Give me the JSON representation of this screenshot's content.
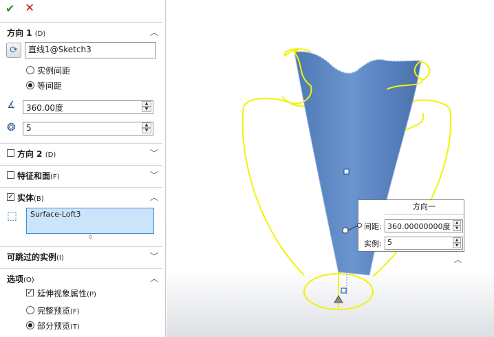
{
  "toolbar": {
    "ok_glyph": "✔",
    "cancel_glyph": "✕"
  },
  "direction1": {
    "title": "方向 1",
    "shortcut": "(D)",
    "reference": "直线1@Sketch3",
    "option_instance_spacing": "实例间距",
    "option_equal_spacing": "等间距",
    "angle": "360.00度",
    "count": "5",
    "selected_option": "等间距"
  },
  "direction2": {
    "title": "方向 2",
    "shortcut": "(D)",
    "checked": false
  },
  "features_faces": {
    "title": "特征和面",
    "shortcut": "(F)",
    "checked": false
  },
  "bodies": {
    "title": "实体",
    "shortcut": "(B)",
    "checked": true,
    "items": [
      "Surface-Loft3"
    ]
  },
  "skip_instances": {
    "title": "可跳过的实例",
    "shortcut": "(I)"
  },
  "options": {
    "title": "选项",
    "shortcut": "(O)",
    "propagate_visual": "延伸视象属性",
    "propagate_shortcut": "(P)",
    "propagate_checked": true,
    "full_preview": "完整预览",
    "full_preview_shortcut": "(F)",
    "partial_preview": "部分预览",
    "partial_preview_shortcut": "(T)",
    "selected_preview": "部分预览"
  },
  "callout": {
    "title": "方向一",
    "spacing_label": "间距:",
    "spacing_value": "360.00000000度",
    "instances_label": "实例:",
    "instances_value": "5"
  },
  "icons": {
    "ok": "checkmark-icon",
    "cancel": "close-icon",
    "direction": "rotate-arrow-icon",
    "angle": "angle-icon",
    "count": "pattern-count-icon",
    "body": "body-icon",
    "chevron_up": "chevron-up-icon",
    "chevron_down": "chevron-down-icon"
  },
  "colors": {
    "accent": "#3b8edc",
    "surface": "#5b86c4",
    "preview_edges": "#f5f500",
    "ok": "#1f9b1f",
    "cancel": "#d21e1e"
  }
}
